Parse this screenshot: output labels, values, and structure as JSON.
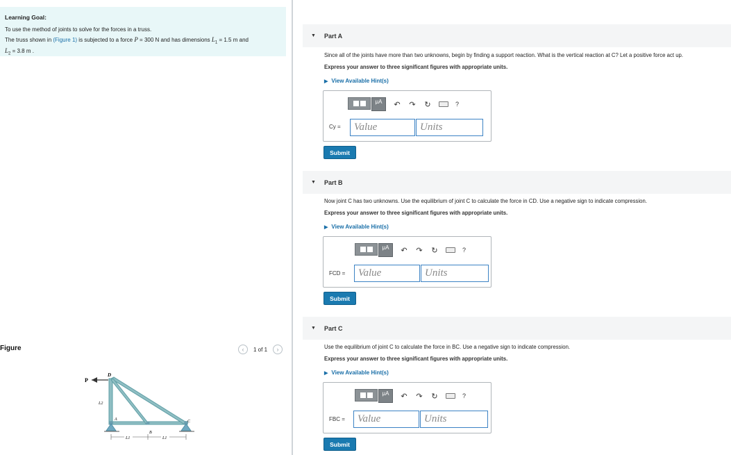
{
  "learning_goal": {
    "title": "Learning Goal:",
    "line1": "To use the method of joints to solve for the forces in a truss.",
    "line2_a": "The truss shown in ",
    "figure_link": "(Figure 1)",
    "line2_b": " is subjected to a force ",
    "P_sym": "P",
    "P_val": " = 300 N and has dimensions ",
    "L1_sym": "L",
    "L1_sub": "1",
    "L1_val": " = 1.5 m and",
    "L2_sym": "L",
    "L2_sub": "2",
    "L2_val": " = 3.8 m ."
  },
  "figure": {
    "label": "Figure",
    "pager_text": "1 of 1",
    "prev_icon": "chevron-left-icon",
    "next_icon": "chevron-right-icon",
    "labels": {
      "P": "P",
      "D": "D",
      "A": "A",
      "B": "B",
      "C": "C",
      "L2": "L2",
      "L1a": "L1",
      "L1b": "L1"
    },
    "colors": {
      "member": "#8fbec3",
      "member_stroke": "#5e9ea5",
      "support": "#6fa8c0"
    }
  },
  "parts": [
    {
      "title": "Part A",
      "question": "Since all of the joints have more than two unknowns, begin by finding a support reaction. What is the vertical reaction at C? Let a positive force act up.",
      "instruction": "Express your answer to three significant figures with appropriate units.",
      "hint": "View Available Hint(s)",
      "var_label": "Cy =",
      "value_placeholder": "Value",
      "units_placeholder": "Units",
      "submit": "Submit"
    },
    {
      "title": "Part B",
      "question": "Now joint C has two unknowns. Use the equilibrium of joint C to calculate the force in CD. Use a negative sign to indicate compression.",
      "instruction": "Express your answer to three significant figures with appropriate units.",
      "hint": "View Available Hint(s)",
      "var_label": "FCD =",
      "value_placeholder": "Value",
      "units_placeholder": "Units",
      "submit": "Submit"
    },
    {
      "title": "Part C",
      "question": "Use the equilibrium of joint C to calculate the force in BC. Use a negative sign to indicate compression.",
      "instruction": "Express your answer to three significant figures with appropriate units.",
      "hint": "View Available Hint(s)",
      "var_label": "FBC =",
      "value_placeholder": "Value",
      "units_placeholder": "Units",
      "submit": "Submit"
    }
  ],
  "toolbar": {
    "mu": "μA",
    "icons": [
      "templates-icon",
      "units-mu-icon",
      "undo-icon",
      "redo-icon",
      "reset-icon",
      "keyboard-icon",
      "help-icon"
    ],
    "help": "?"
  }
}
